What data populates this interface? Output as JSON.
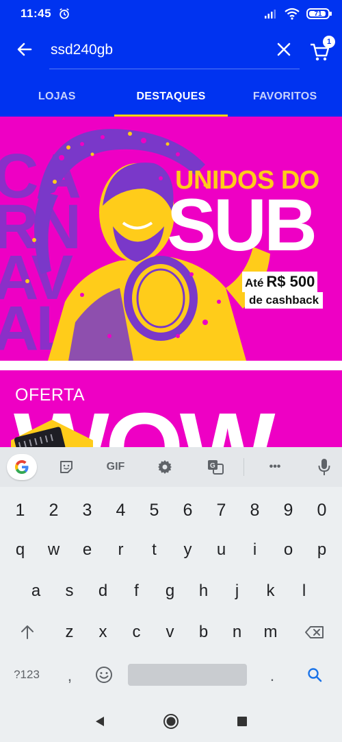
{
  "status_bar": {
    "time": "11:45",
    "battery": "71"
  },
  "search": {
    "query": "ssd240gb"
  },
  "cart": {
    "badge": "1"
  },
  "tabs": [
    {
      "label": "LOJAS"
    },
    {
      "label": "DESTAQUES"
    },
    {
      "label": "FAVORITOS"
    }
  ],
  "banner_carnaval": {
    "bg_text": "CARNAVAL",
    "headline_top": "UNIDOS DO",
    "headline_main": "SUB",
    "cashback_prefix": "Até",
    "cashback_amount": "R$ 500",
    "cashback_suffix": "de cashback"
  },
  "banner_oferta": {
    "label": "OFERTA",
    "headline": "WOW"
  },
  "keyboard": {
    "toolbar": {
      "gif_label": "GIF",
      "more_label": "•••"
    },
    "number_row": [
      "1",
      "2",
      "3",
      "4",
      "5",
      "6",
      "7",
      "8",
      "9",
      "0"
    ],
    "row1": [
      "q",
      "w",
      "e",
      "r",
      "t",
      "y",
      "u",
      "i",
      "o",
      "p"
    ],
    "row2": [
      "a",
      "s",
      "d",
      "f",
      "g",
      "h",
      "j",
      "k",
      "l"
    ],
    "row3": [
      "z",
      "x",
      "c",
      "v",
      "b",
      "n",
      "m"
    ],
    "symbols_label": "?123",
    "comma": ",",
    "period": "."
  },
  "colors": {
    "header_blue": "#0033f0",
    "tab_indicator": "#f5d300",
    "banner_magenta": "#ee00c4",
    "banner_yellow": "#ffcc1a",
    "banner_purple": "#7a38c9"
  }
}
